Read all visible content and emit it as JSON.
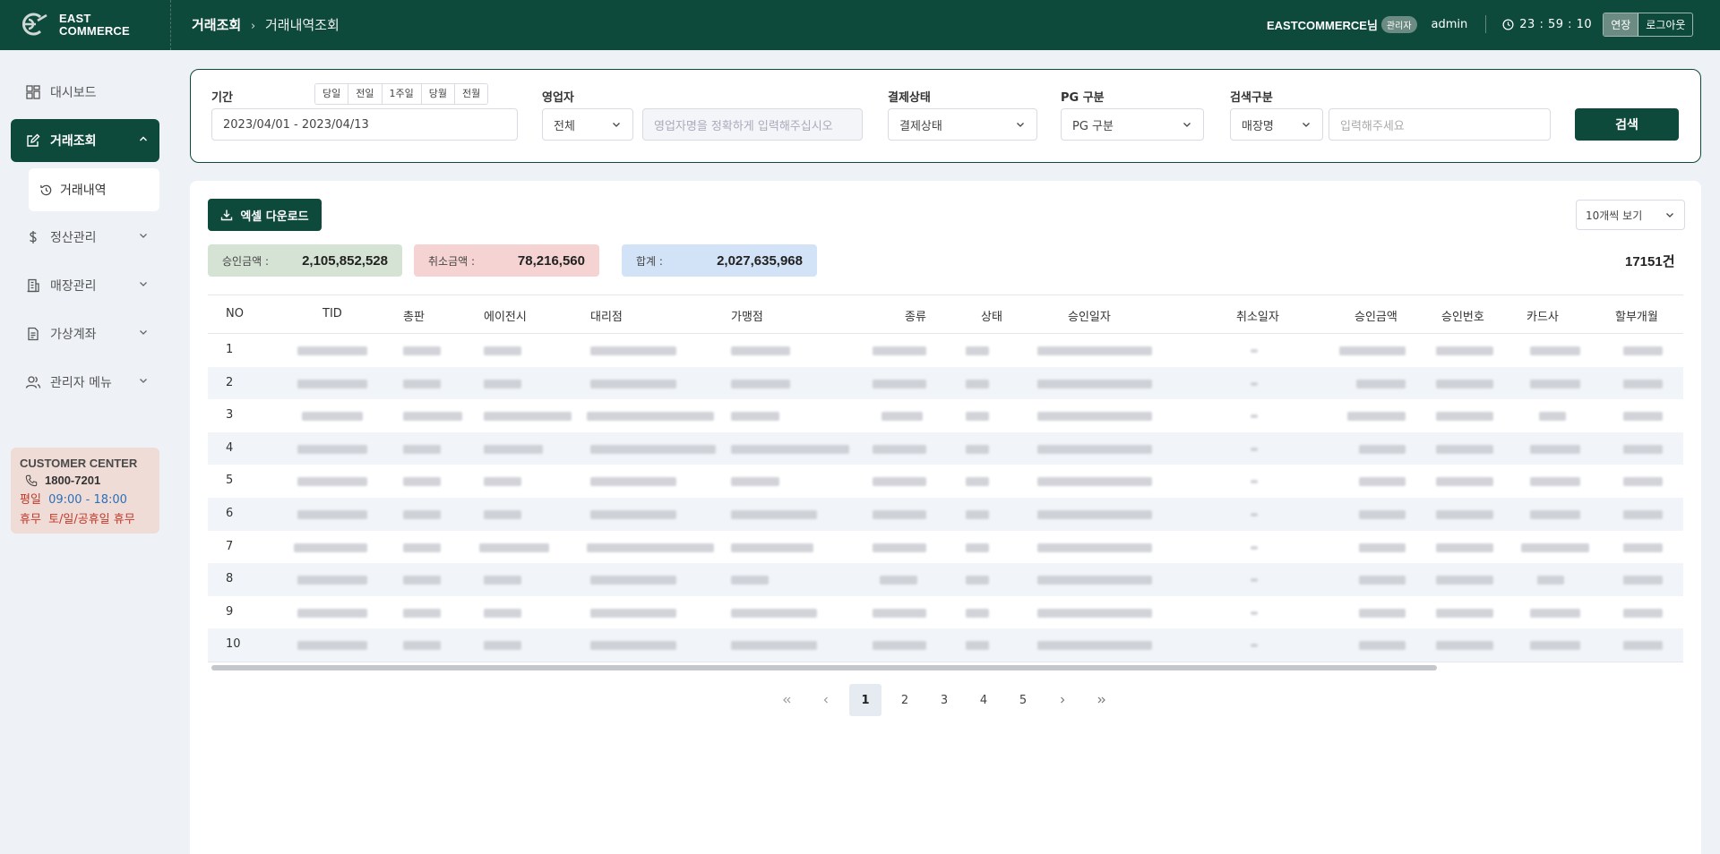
{
  "header": {
    "logo_line1": "EAST",
    "logo_line2": "COMMERCE",
    "breadcrumb_current": "거래조회",
    "breadcrumb_sep": "›",
    "breadcrumb_sub": "거래내역조회",
    "user_name": "EASTCOMMERCE님",
    "role_badge": "관리자",
    "user_id": "admin",
    "timer": "23 : 59 : 10",
    "extend_label": "연장",
    "logout_label": "로그아웃",
    "brand_color": "#0e4a3b"
  },
  "sidebar": {
    "items": [
      {
        "label": "대시보드",
        "icon": "dashboard-icon"
      },
      {
        "label": "거래조회",
        "icon": "edit-icon",
        "active": true
      },
      {
        "label": "정산관리",
        "icon": "dollar-icon"
      },
      {
        "label": "매장관리",
        "icon": "building-icon"
      },
      {
        "label": "가상계좌",
        "icon": "document-icon"
      },
      {
        "label": "관리자 메뉴",
        "icon": "users-icon"
      }
    ],
    "sub_item": {
      "label": "거래내역",
      "icon": "history-icon"
    },
    "customer_center": {
      "title": "CUSTOMER CENTER",
      "phone": "1800-7201",
      "weekday_label": "평일",
      "weekday_hours": "09:00 - 18:00",
      "holiday_label": "휴무",
      "holiday_value": "토/일/공휴일 휴무"
    }
  },
  "search": {
    "period_label": "기간",
    "period_buttons": [
      "당일",
      "전일",
      "1주일",
      "당월",
      "전월"
    ],
    "period_value": "2023/04/01 - 2023/04/13",
    "sales_label": "영업자",
    "sales_select": "전체",
    "sales_placeholder": "영업자명을 정확하게 입력해주십시오",
    "status_label": "결제상태",
    "status_select": "결제상태",
    "pg_label": "PG 구분",
    "pg_select": "PG 구분",
    "type_label": "검색구분",
    "type_select": "매장명",
    "keyword_placeholder": "입력해주세요",
    "search_button": "검색"
  },
  "content": {
    "excel_button": "엑셀 다운로드",
    "page_size": "10개씩 보기",
    "approve_label": "승인금액 :",
    "approve_value": "2,105,852,528",
    "cancel_label": "취소금액 :",
    "cancel_value": "78,216,560",
    "total_label": "합계 :",
    "total_value": "2,027,635,968",
    "total_count": "17151건",
    "columns": [
      "NO",
      "TID",
      "총판",
      "에이전시",
      "대리점",
      "가맹점",
      "종류",
      "상태",
      "승인일자",
      "취소일자",
      "승인금액",
      "승인번호",
      "카드사",
      "할부개월"
    ],
    "row_numbers": [
      "1",
      "2",
      "3",
      "4",
      "5",
      "6",
      "7",
      "8",
      "9",
      "10"
    ],
    "pages": [
      "1",
      "2",
      "3",
      "4",
      "5"
    ],
    "current_page": "1"
  }
}
